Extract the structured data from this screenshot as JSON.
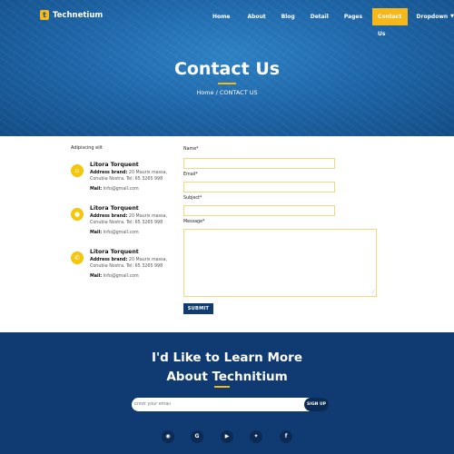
{
  "brand": {
    "badge": "t",
    "name": "Technetium"
  },
  "nav": {
    "items": [
      "Home",
      "About",
      "Blog",
      "Detail",
      "Pages",
      "Contact Us",
      "Dropdown"
    ],
    "active": "Contact Us"
  },
  "hero": {
    "title": "Contact Us",
    "breadcrumb": "Home / CONTACT US"
  },
  "addresses": {
    "title": "Adipiscing elit",
    "cards": [
      {
        "icon": "home-icon",
        "name": "Litora Torquent",
        "address_label": "Address brand:",
        "address_line1": "20 Mauris massa,",
        "address_line2": "Conubia Nostra. Tel: 65 3265 998",
        "mail_label": "Mail:",
        "mail": "Info@gmail.com"
      },
      {
        "icon": "pin-icon",
        "name": "Litora Torquent",
        "address_label": "Address brand:",
        "address_line1": "20 Mauris massa,",
        "address_line2": "Conubia Nostra. Tel: 65 3265 998",
        "mail_label": "Mail:",
        "mail": "Info@gmail.com"
      },
      {
        "icon": "phone-icon",
        "name": "Litora Torquent",
        "address_label": "Address brand:",
        "address_line1": "20 Mauris massa,",
        "address_line2": "Conubia Nostra. Tel: 65 3265 998",
        "mail_label": "Mail:",
        "mail": "Info@gmail.com"
      }
    ]
  },
  "form": {
    "name_label": "Name*",
    "email_label": "Email*",
    "subject_label": "Subject*",
    "message_label": "Message*",
    "submit": "SUBMIT"
  },
  "footer": {
    "title_line1": "I'd Like to Learn More",
    "title_line2": "About Technitium",
    "newsletter_placeholder": "Enter your email",
    "signup": "SIGN UP",
    "socials": [
      "github-icon",
      "google-icon",
      "youtube-icon",
      "twitter-icon",
      "facebook-icon"
    ]
  },
  "colors": {
    "accent": "#f5b719",
    "hero": "#1f68ab",
    "footer": "#103a72",
    "button": "#123b70"
  }
}
